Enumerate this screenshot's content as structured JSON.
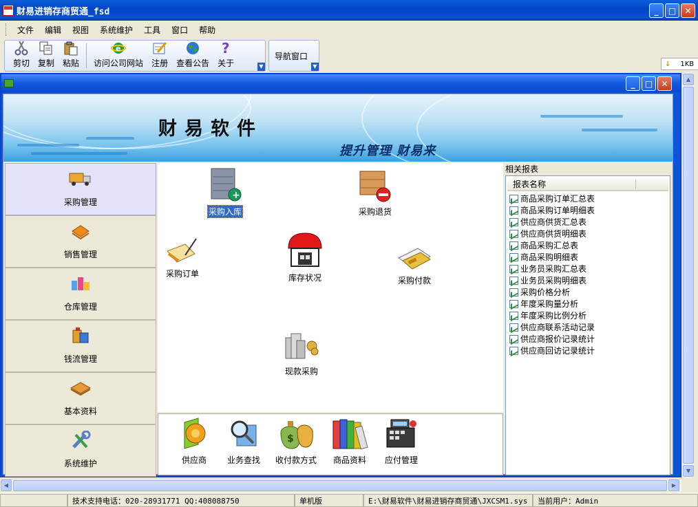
{
  "window": {
    "title": "财易进销存商贸通_fsd"
  },
  "menu": [
    "文件",
    "编辑",
    "视图",
    "系统维护",
    "工具",
    "窗口",
    "帮助"
  ],
  "toolbar": {
    "cut": "剪切",
    "copy": "复制",
    "paste": "粘贴",
    "website": "访问公司网站",
    "register": "注册",
    "notice": "查看公告",
    "about": "关于",
    "nav_window": "导航窗口",
    "download": "1KB"
  },
  "banner": {
    "title": "财易软件",
    "slogan": "提升管理 财易来"
  },
  "leftnav": [
    "采购管理",
    "销售管理",
    "仓库管理",
    "钱流管理",
    "基本资料",
    "系统维护"
  ],
  "center": {
    "purchase_in": "采购入库",
    "purchase_return": "采购退货",
    "purchase_order": "采购订单",
    "stock_status": "库存状况",
    "purchase_pay": "采购付款",
    "cash_purchase": "现款采购"
  },
  "bottom": [
    "供应商",
    "业务查找",
    "收付款方式",
    "商品资料",
    "应付管理"
  ],
  "reports": {
    "title": "相关报表",
    "header": "报表名称",
    "items": [
      "商品采购订单汇总表",
      "商品采购订单明细表",
      "供应商供货汇总表",
      "供应商供货明细表",
      "商品采购汇总表",
      "商品采购明细表",
      "业务员采购汇总表",
      "业务员采购明细表",
      "采购价格分析",
      "年度采购量分析",
      "年度采购比例分析",
      "供应商联系活动记录",
      "供应商报价记录统计",
      "供应商回访记录统计"
    ]
  },
  "status": {
    "support": "技术支持电话：020-28931771 QQ:408088750",
    "mode": "单机版",
    "path": "E:\\财易软件\\财易进销存商贸通\\JXCSM1.sys",
    "user": "当前用户：Admin"
  }
}
